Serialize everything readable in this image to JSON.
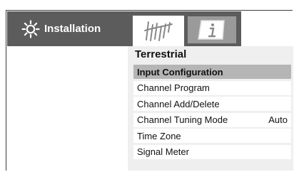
{
  "header": {
    "title": "Installation",
    "title_icon": "gear-icon",
    "tabs": [
      {
        "icon": "antenna-icon",
        "active": true
      },
      {
        "icon": "info-icon",
        "active": false
      }
    ]
  },
  "section": {
    "title": "Terrestrial"
  },
  "menu": {
    "items": [
      {
        "label": "Input Configuration",
        "value": "",
        "selected": true
      },
      {
        "label": "Channel Program",
        "value": "",
        "selected": false
      },
      {
        "label": "Channel Add/Delete",
        "value": "",
        "selected": false
      },
      {
        "label": "Channel Tuning Mode",
        "value": "Auto",
        "selected": false
      },
      {
        "label": "Time Zone",
        "value": "",
        "selected": false
      },
      {
        "label": "Signal Meter",
        "value": "",
        "selected": false
      }
    ]
  },
  "colors": {
    "header_bg": "#5c5c5c",
    "selected_bg": "#b5b5b5",
    "panel_bg": "#efefef"
  }
}
